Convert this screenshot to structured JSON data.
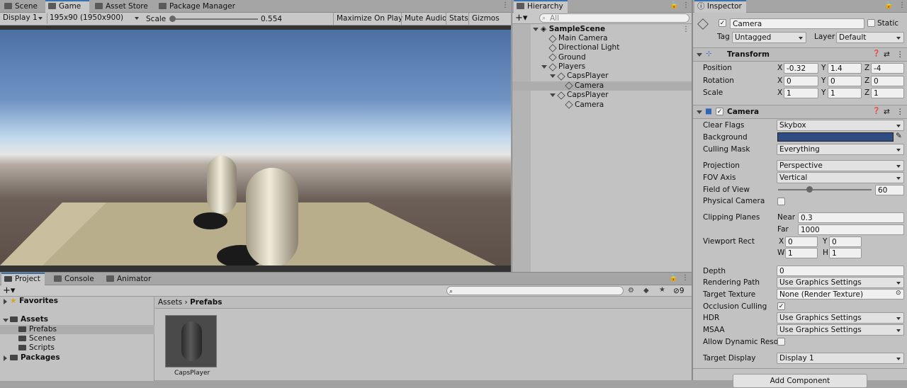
{
  "game_view": {
    "tabs": [
      "Scene",
      "Game",
      "Asset Store",
      "Package Manager"
    ],
    "display": "Display 1",
    "resolution": "195x90 (1950x900)",
    "scale_label": "Scale",
    "scale_value": "0.554",
    "scale_fraction": 0.35,
    "buttons": [
      "Maximize On Play",
      "Mute Audio",
      "Stats",
      "Gizmos"
    ]
  },
  "hierarchy": {
    "tab": "Hierarchy",
    "search_placeholder": "All",
    "scene": "SampleScene",
    "items": [
      "Main Camera",
      "Directional Light",
      "Ground",
      "Players",
      "CapsPlayer",
      "Camera",
      "CapsPlayer",
      "Camera"
    ]
  },
  "project": {
    "tabs": [
      "Project",
      "Console",
      "Animator"
    ],
    "favorites": "Favorites",
    "assets": "Assets",
    "folders": [
      "Prefabs",
      "Scenes",
      "Scripts"
    ],
    "packages": "Packages",
    "breadcrumb": [
      "Assets",
      "Prefabs"
    ],
    "asset_name": "CapsPlayer",
    "hidden_count": "9"
  },
  "inspector": {
    "tab": "Inspector",
    "object_name": "Camera",
    "static_label": "Static",
    "tag_label": "Tag",
    "tag_value": "Untagged",
    "layer_label": "Layer",
    "layer_value": "Default",
    "transform": {
      "title": "Transform",
      "position_label": "Position",
      "position": [
        "-0.32",
        "1.4",
        "-4"
      ],
      "rotation_label": "Rotation",
      "rotation": [
        "0",
        "0",
        "0"
      ],
      "scale_label": "Scale",
      "scale": [
        "1",
        "1",
        "1"
      ],
      "axes": [
        "X",
        "Y",
        "Z"
      ]
    },
    "camera": {
      "title": "Camera",
      "background_color": "#2f4c85",
      "clear_flags_label": "Clear Flags",
      "clear_flags": "Skybox",
      "background_label": "Background",
      "culling_mask_label": "Culling Mask",
      "culling_mask": "Everything",
      "projection_label": "Projection",
      "projection": "Perspective",
      "fov_axis_label": "FOV Axis",
      "fov_axis": "Vertical",
      "fov_label": "Field of View",
      "fov": "60",
      "fov_fraction": 0.34,
      "physical_label": "Physical Camera",
      "clipping_label": "Clipping Planes",
      "near_label": "Near",
      "near": "0.3",
      "far_label": "Far",
      "far": "1000",
      "viewport_label": "Viewport Rect",
      "vx": "0",
      "vy": "0",
      "vw": "1",
      "vh": "1",
      "vlabels": [
        "X",
        "Y",
        "W",
        "H"
      ],
      "depth_label": "Depth",
      "depth": "0",
      "rendering_path_label": "Rendering Path",
      "rendering_path": "Use Graphics Settings",
      "target_texture_label": "Target Texture",
      "target_texture": "None (Render Texture)",
      "occlusion_label": "Occlusion Culling",
      "hdr_label": "HDR",
      "hdr": "Use Graphics Settings",
      "msaa_label": "MSAA",
      "msaa": "Use Graphics Settings",
      "dyn_res_label": "Allow Dynamic Resol",
      "target_display_label": "Target Display",
      "target_display": "Display 1"
    },
    "add_component": "Add Component"
  }
}
